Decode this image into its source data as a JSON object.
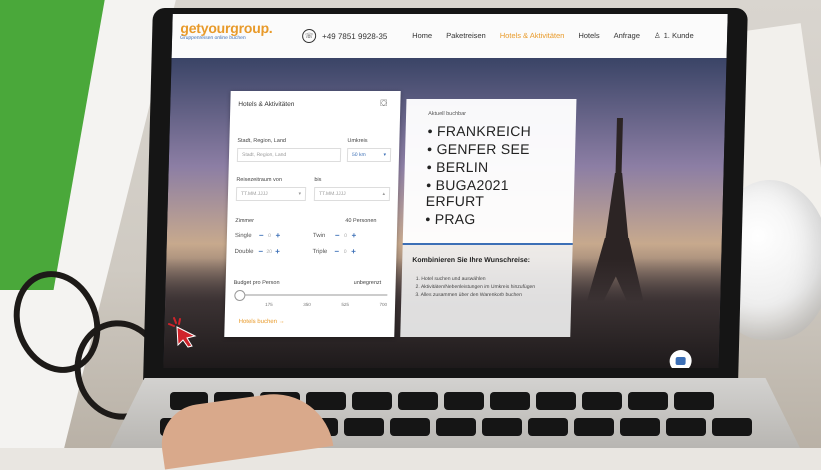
{
  "site": {
    "logo_text": "getyourgroup.",
    "logo_tagline": "Gruppenreisen online buchen",
    "phone": "+49 7851 9928-35",
    "nav": [
      "Home",
      "Paketreisen",
      "Hotels & Aktivitäten",
      "Hotels",
      "Anfrage"
    ],
    "user_label": "1. Kunde"
  },
  "form": {
    "title": "Hotels & Aktivitäten",
    "city_label": "Stadt, Region, Land",
    "city_placeholder": "Stadt, Region, Land",
    "radius_label": "Umkreis",
    "radius_value": "50 km",
    "from_label": "Reisezeitraum von",
    "from_value": "TT.MM.JJJJ",
    "to_label": "bis",
    "to_value": "TT.MM.JJJJ",
    "rooms_label": "Zimmer",
    "persons_label": "40 Personen",
    "single_label": "Single",
    "single_value": "0",
    "twin_label": "Twin",
    "twin_value": "0",
    "double_label": "Double",
    "double_value": "20",
    "triple_label": "Triple",
    "triple_value": "0",
    "budget_label": "Budget pro Person",
    "budget_max": "unbegrenzt",
    "ticks": [
      "175",
      "350",
      "525",
      "700"
    ],
    "submit_label": "Hotels buchen →"
  },
  "info": {
    "subtitle": "Aktuell buchbar",
    "destinations": [
      "• FRANKREICH",
      "• GENFER SEE",
      "• BERLIN",
      "• BUGA2021",
      "ERFURT",
      "• PRAG"
    ]
  },
  "combo": {
    "title": "Kombinieren Sie Ihre Wunschreise:",
    "steps": [
      "1. Hotel suchen und auswählen",
      "2. Aktivitäten/Nebenleistungen im Umkreis hinzufügen",
      "3. Alles zusammen über den Warenkorb buchen"
    ]
  }
}
